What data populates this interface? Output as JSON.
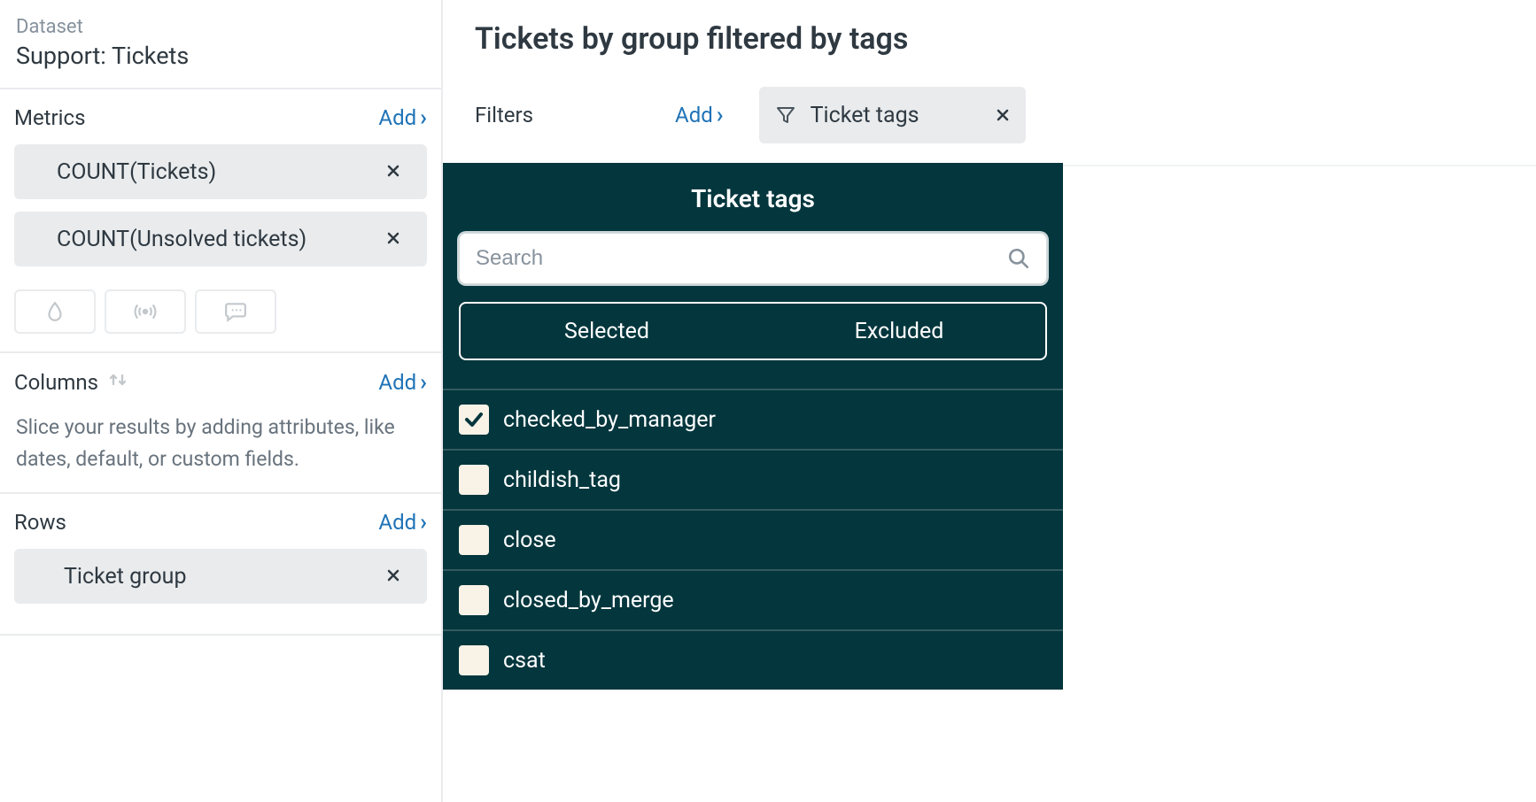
{
  "sidebar": {
    "dataset_label": "Dataset",
    "dataset_name": "Support: Tickets",
    "metrics": {
      "title": "Metrics",
      "add": "Add",
      "items": [
        {
          "label": "COUNT(Tickets)"
        },
        {
          "label": "COUNT(Unsolved tickets)"
        }
      ]
    },
    "columns": {
      "title": "Columns",
      "add": "Add",
      "hint": "Slice your results by adding attributes, like dates, default, or custom fields."
    },
    "rows": {
      "title": "Rows",
      "add": "Add",
      "items": [
        {
          "label": "Ticket group"
        }
      ]
    }
  },
  "main": {
    "title": "Tickets by group filtered by tags",
    "filters_label": "Filters",
    "filters_add": "Add",
    "filter_chip": "Ticket tags"
  },
  "panel": {
    "title": "Ticket tags",
    "search_placeholder": "Search",
    "tab_selected": "Selected",
    "tab_excluded": "Excluded",
    "tags": [
      {
        "label": "checked_by_manager",
        "checked": true
      },
      {
        "label": "childish_tag",
        "checked": false
      },
      {
        "label": "close",
        "checked": false
      },
      {
        "label": "closed_by_merge",
        "checked": false
      },
      {
        "label": "csat",
        "checked": false
      }
    ]
  }
}
